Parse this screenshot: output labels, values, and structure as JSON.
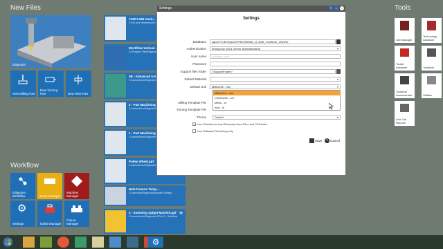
{
  "sections": {
    "new_files": "New Files",
    "workflow": "Workflow",
    "tools": "Tools"
  },
  "new_files": {
    "edgecam_label": "Edgecam",
    "milling_label": "New Milling Part",
    "turning_label": "New Turning Part",
    "wire_label": "New Wire Part"
  },
  "recent_files": [
    {
      "name": "7439-5 MH Casti...",
      "path": "C:\\UK and Newberry\\Jo\\ 1(0)C-Overseer"
    },
    {
      "name": "Workflow Vertical ...",
      "path": "C:\\Program Files\\Edgecam\\ Sam\\Examples\\Feature"
    },
    {
      "name": "3B - Advanced 5-A...",
      "path": "C:\\users\\demo\\Edgecam\\ Milling\\3D-5 Advanced 5-Axis"
    },
    {
      "name": "2 - Part Machining ...",
      "path": "C:\\users\\demo\\Edgecam\\ Milling\\2 - Work"
    },
    {
      "name": "1 - Part Machining ...",
      "path": "C:\\users\\demo\\Edgecam\\ Milling\\2 - Work"
    },
    {
      "name": "Pulley Wheel.ppf",
      "path": "C:\\users\\demo\\Edgecam\\ Turning\\1 - Turning"
    },
    {
      "name": "Hole Feature Temp...",
      "path": "C:\\users\\ma\\Edgecam\\Sampled\\ Milling\\"
    },
    {
      "name": "3 - Summing Spigot Machini.ppf",
      "path": "C:\\users\\demo\\Edgecam\\ 3\\Part 3 - Workflow"
    }
  ],
  "workflow_tiles": {
    "edgecam_workflow": "Edgecam Workflow",
    "stock_manager": "Stock Manager",
    "machine_manager": "Machine Manager",
    "settings": "Settings",
    "toolkit_manager": "Toolkit Manager",
    "fixture_manager": "Fixture Manager"
  },
  "tools_tiles": {
    "job_manager": "Job Manager",
    "technology_assistant": "Technology Assistant",
    "toolkit_assistant": "Toolkit Assistant",
    "toolstore": "Toolstore",
    "toolstore_admin": "Toolstore Administrator",
    "utilities": "Utilities",
    "live_job_reports": "Live Job Reports"
  },
  "dialog": {
    "window_title": "Settings",
    "heading": "Settings",
    "labels": {
      "database": "Database",
      "authentication": "Authentication",
      "user_name": "User name",
      "password": "Password",
      "support_files_folder": "Support files folder",
      "default_material": "Default Material",
      "default_unit": "Default Unit",
      "milling_template": "Milling Template File",
      "turning_template": "Turning Template File",
      "theme": "Theme"
    },
    "values": {
      "database": "lap02-PC\\ECSQLEXPRESS\\Mike_O_Neill_ToolStore_2014R2",
      "authentication": "Workgroup (SQL Server Authentication)",
      "user_name": "toolstore_user",
      "password": "",
      "support_files_folder": "<SupportFolder>",
      "default_material": "",
      "default_unit": "Millimetre - mm",
      "theme": "Default"
    },
    "unit_options": [
      "Millimetre - mm",
      "Centimetre - cm",
      "Metre - m",
      "Inch - in"
    ],
    "checkboxes": {
      "recent_files": "Use Workflow to load Recently Used Files and CADLinks",
      "software_rendering": "Use Software Rendering only"
    },
    "save_label": "Save",
    "cancel_label": "Cancel"
  },
  "colors": {
    "desktop": "#6f7b70",
    "tile_blue": "#1f6fb6",
    "stock_yellow": "#e8b012",
    "machine_red": "#a01c1c",
    "dropdown_highlight": "#f2a33a"
  }
}
